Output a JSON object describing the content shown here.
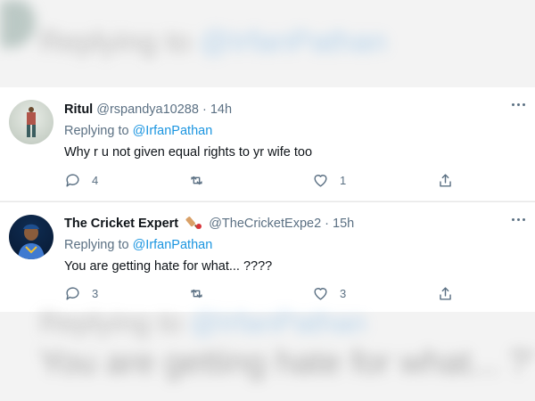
{
  "background": {
    "top_replying_prefix": "Replying to",
    "top_replying_handle": "@IrfanPathan",
    "bottom_replying_prefix": "Replying to",
    "bottom_replying_handle": "@IrfanPathan",
    "bottom_text": "You are getting hate for what... ????"
  },
  "tweets": [
    {
      "name": "Ritul",
      "handle": "@rspandya10288",
      "separator": "·",
      "time": "14h",
      "replying_prefix": "Replying to",
      "replying_handle": "@IrfanPathan",
      "text": "Why r u not given equal rights to yr wife too",
      "reply_count": "4",
      "retweet_count": "",
      "like_count": "1"
    },
    {
      "name": "The Cricket Expert",
      "badge_icon": "cricket-bat-emoji",
      "handle": "@TheCricketExpe2",
      "separator": "·",
      "time": "15h",
      "replying_prefix": "Replying to",
      "replying_handle": "@IrfanPathan",
      "text": "You are getting hate for what... ????",
      "reply_count": "3",
      "retweet_count": "",
      "like_count": "3"
    }
  ],
  "colors": {
    "link": "#1b95e0",
    "secondary": "#5b7083",
    "primary_text": "#0f1419"
  }
}
